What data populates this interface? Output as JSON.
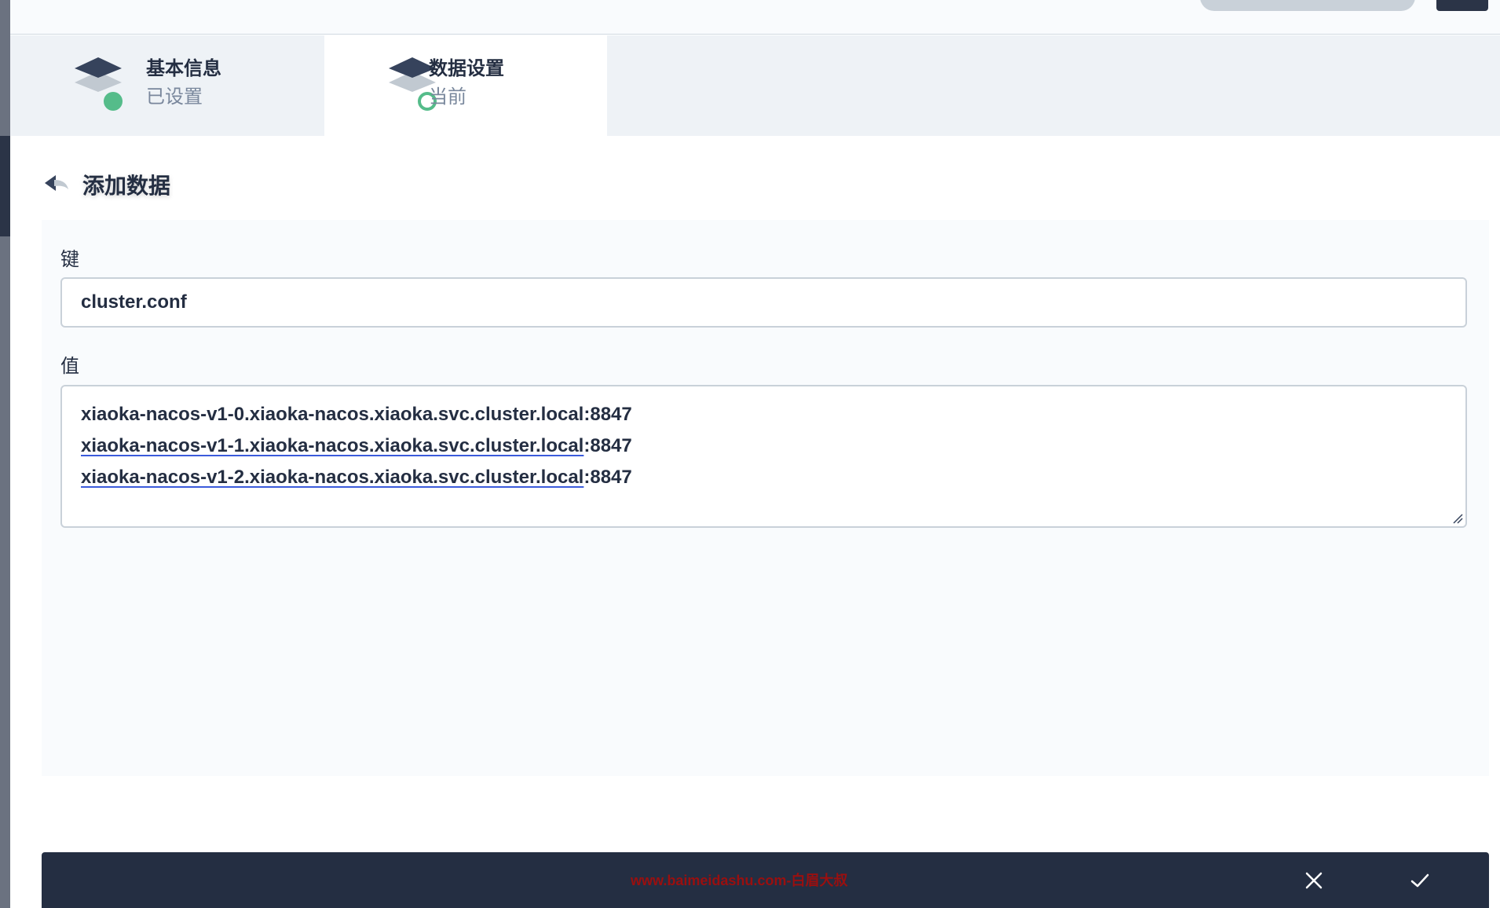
{
  "tabs": [
    {
      "title": "基本信息",
      "status": "已设置",
      "icon": "layers-done-icon"
    },
    {
      "title": "数据设置",
      "status": "当前",
      "icon": "layers-current-icon"
    }
  ],
  "section": {
    "title": "添加数据",
    "back_icon": "back-arrow-icon"
  },
  "form": {
    "key_label": "键",
    "key_value": "cluster.conf",
    "value_label": "值",
    "value_lines": [
      {
        "host": "xiaoka-nacos-v1-0.xiaoka-nacos.xiaoka.svc.cluster.local",
        "port": ":8847"
      },
      {
        "host": "xiaoka-nacos-v1-1.xiaoka-nacos.xiaoka.svc.cluster.local",
        "port": ":8847"
      },
      {
        "host": "xiaoka-nacos-v1-2.xiaoka-nacos.xiaoka.svc.cluster.local",
        "port": ":8847"
      }
    ]
  },
  "footer": {
    "watermark": "www.baimeidashu.com-白眉大叔",
    "cancel_icon": "close-icon",
    "confirm_icon": "check-icon"
  },
  "colors": {
    "primary_dark": "#242e42",
    "success_green": "#55bc8a",
    "muted_text": "#79879c",
    "tab_background": "#eef2f6",
    "watermark_red": "#9a0f0f"
  }
}
